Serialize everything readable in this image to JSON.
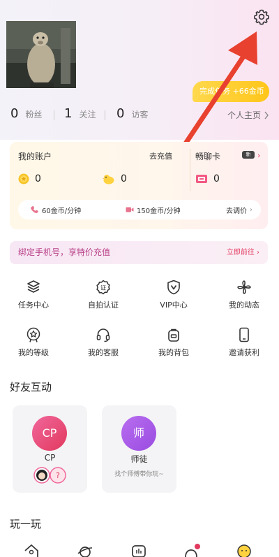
{
  "header": {
    "task_pill": "完成任务 +66金币"
  },
  "stats": [
    {
      "count": "0",
      "label": "粉丝"
    },
    {
      "count": "1",
      "label": "关注"
    },
    {
      "count": "0",
      "label": "访客"
    }
  ],
  "homepage_link": "个人主页",
  "account": {
    "title": "我的账户",
    "recharge": "去充值",
    "chat_card": "畅聊卡",
    "new_badge": "新",
    "gold_coins": "0",
    "duck_coins": "0",
    "chat_cards": "0",
    "voice_price": "60金币/分钟",
    "video_price": "150金币/分钟",
    "adjust_price": "去调价"
  },
  "bind_banner": {
    "text": "绑定手机号，享特价充值",
    "action": "立即前往"
  },
  "menu": [
    {
      "label": "任务中心",
      "icon": "layers-icon"
    },
    {
      "label": "自拍认证",
      "icon": "certified-badge-icon"
    },
    {
      "label": "VIP中心",
      "icon": "vip-shield-icon"
    },
    {
      "label": "我的动态",
      "icon": "pinwheel-icon"
    },
    {
      "label": "我的等级",
      "icon": "level-star-icon"
    },
    {
      "label": "我的客服",
      "icon": "headset-icon"
    },
    {
      "label": "我的背包",
      "icon": "backpack-icon"
    },
    {
      "label": "邀请获利",
      "icon": "phone-icon"
    }
  ],
  "friends": {
    "title": "好友互动",
    "cards": [
      {
        "badge": "CP",
        "name": "CP",
        "sub": ""
      },
      {
        "badge": "师",
        "name": "师徒",
        "sub": "找个师傅带你玩~"
      }
    ]
  },
  "play": {
    "title": "玩一玩"
  },
  "colors": {
    "accent_pink": "#e2395e",
    "cp_gradient_start": "#f0679b",
    "mentor_gradient_start": "#b86ef0",
    "task_pill": "#ffc61a",
    "arrow_red": "#e8412f"
  }
}
